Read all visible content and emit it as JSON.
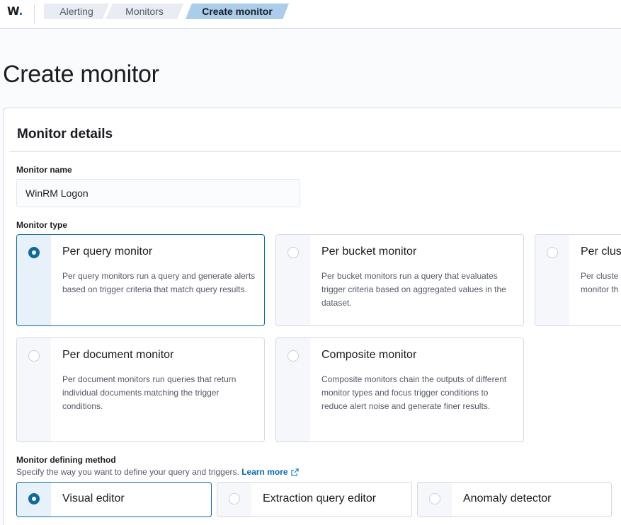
{
  "header": {
    "logo": "W",
    "logo_dot": ".",
    "breadcrumbs": [
      "Alerting",
      "Monitors",
      "Create monitor"
    ]
  },
  "page": {
    "title": "Create monitor"
  },
  "details": {
    "section_title": "Monitor details",
    "name_label": "Monitor name",
    "name_value": "WinRM Logon",
    "type_label": "Monitor type",
    "types": [
      {
        "title": "Per query monitor",
        "description": "Per query monitors run a query and generate alerts based on trigger criteria that match query results.",
        "selected": true
      },
      {
        "title": "Per bucket monitor",
        "description": "Per bucket monitors run a query that evaluates trigger criteria based on aggregated values in the dataset.",
        "selected": false
      },
      {
        "title": "Per clus",
        "description": "Per cluste monitor th",
        "selected": false
      },
      {
        "title": "Per document monitor",
        "description": "Per document monitors run queries that return individual documents matching the trigger conditions.",
        "selected": false
      },
      {
        "title": "Composite monitor",
        "description": "Composite monitors chain the outputs of different monitor types and focus trigger conditions to reduce alert noise and generate finer results.",
        "selected": false
      }
    ],
    "method_label": "Monitor defining method",
    "method_help": "Specify the way you want to define your query and triggers.",
    "learn_more": "Learn more",
    "methods": [
      {
        "title": "Visual editor",
        "selected": true
      },
      {
        "title": "Extraction query editor",
        "selected": false
      },
      {
        "title": "Anomaly detector",
        "selected": false
      }
    ]
  },
  "colors": {
    "accent": "#0d6aa0",
    "link": "#006bb8",
    "selected_crumb": "#a9cdeb"
  }
}
